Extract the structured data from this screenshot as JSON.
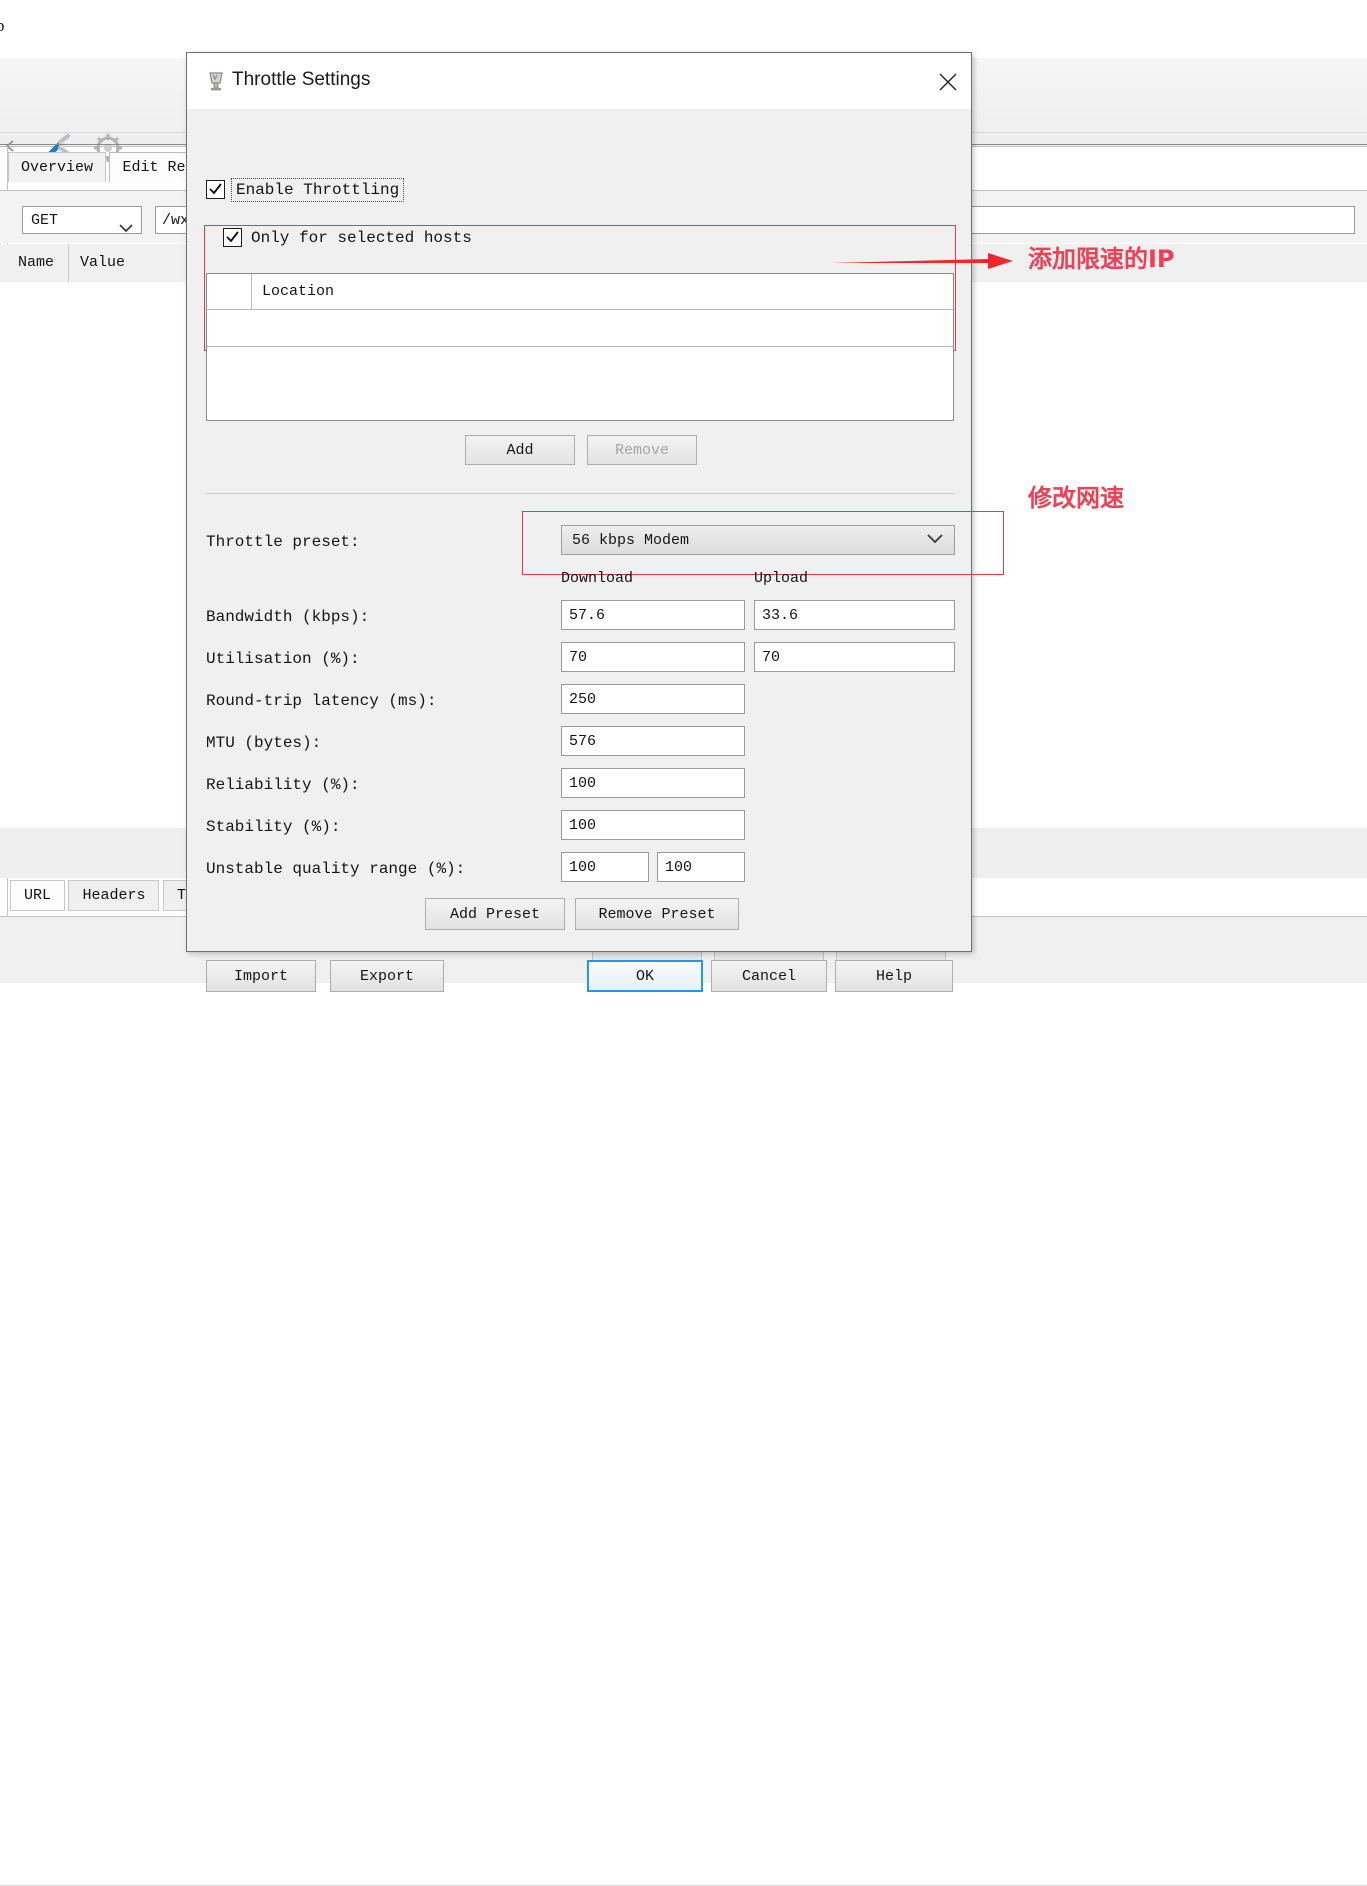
{
  "background_app": {
    "menu_label": "p",
    "toolbar_icons": [
      "tools-icon",
      "gear-icon"
    ],
    "tabs": [
      {
        "label": "Overview",
        "active": false
      },
      {
        "label": "Edit Requ",
        "active": true
      }
    ],
    "request": {
      "method": "GET",
      "url": "/wx"
    },
    "table_headers": [
      "Name",
      "Value"
    ],
    "bottom_tabs": [
      {
        "label": "URL",
        "active": true
      },
      {
        "label": "Headers",
        "active": false
      },
      {
        "label": "Text",
        "active": false
      }
    ]
  },
  "dialog": {
    "title": "Throttle Settings",
    "icon": "throttle-icon",
    "close_label": "×",
    "enable_throttling": {
      "label": "Enable Throttling",
      "checked": true
    },
    "only_selected_hosts": {
      "label": "Only for selected hosts",
      "checked": true
    },
    "hosts_table": {
      "columns": [
        "",
        "Location"
      ],
      "rows": []
    },
    "host_buttons": [
      {
        "label": "Add",
        "enabled": true
      },
      {
        "label": "Remove",
        "enabled": false
      }
    ],
    "throttle_preset": {
      "label": "Throttle preset:",
      "value": "56 kbps Modem"
    },
    "column_headers": {
      "download": "Download",
      "upload": "Upload"
    },
    "fields": [
      {
        "label": "Bandwidth (kbps):",
        "download": "57.6",
        "upload": "33.6",
        "two_col": true
      },
      {
        "label": "Utilisation (%):",
        "download": "70",
        "upload": "70",
        "two_col": true
      },
      {
        "label": "Round-trip latency (ms):",
        "download": "250",
        "upload": null,
        "two_col": false
      },
      {
        "label": "MTU (bytes):",
        "download": "576",
        "upload": null,
        "two_col": false
      },
      {
        "label": "Reliability (%):",
        "download": "100",
        "upload": null,
        "two_col": false
      },
      {
        "label": "Stability (%):",
        "download": "100",
        "upload": null,
        "two_col": false
      },
      {
        "label": "Unstable quality range (%):",
        "download": "100",
        "upload": "100",
        "two_col": true,
        "narrow": true
      }
    ],
    "preset_buttons": [
      {
        "label": "Add Preset",
        "enabled": true
      },
      {
        "label": "Remove Preset",
        "enabled": true
      }
    ],
    "footer_buttons": [
      {
        "label": "Import",
        "enabled": true,
        "default": false
      },
      {
        "label": "Export",
        "enabled": true,
        "default": false
      },
      {
        "label": "OK",
        "enabled": true,
        "default": true
      },
      {
        "label": "Cancel",
        "enabled": true,
        "default": false
      },
      {
        "label": "Help",
        "enabled": true,
        "default": false
      }
    ]
  },
  "annotations": [
    {
      "text": "添加限速的IP",
      "color": "#ef4056",
      "target": "hosts-table"
    },
    {
      "text": "修改网速",
      "color": "#ef4056",
      "target": "throttle-preset"
    }
  ]
}
